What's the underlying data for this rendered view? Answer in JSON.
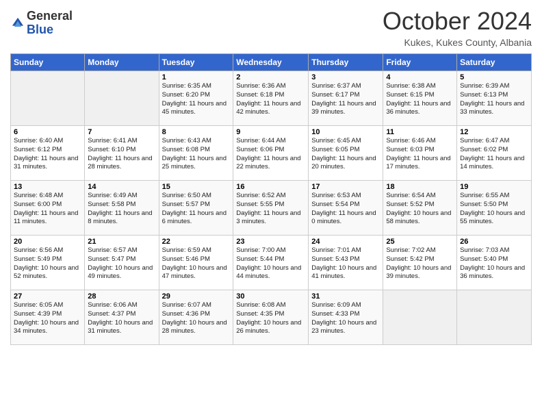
{
  "logo": {
    "general": "General",
    "blue": "Blue"
  },
  "title": "October 2024",
  "subtitle": "Kukes, Kukes County, Albania",
  "days_of_week": [
    "Sunday",
    "Monday",
    "Tuesday",
    "Wednesday",
    "Thursday",
    "Friday",
    "Saturday"
  ],
  "weeks": [
    [
      {
        "num": "",
        "info": ""
      },
      {
        "num": "",
        "info": ""
      },
      {
        "num": "1",
        "info": "Sunrise: 6:35 AM\nSunset: 6:20 PM\nDaylight: 11 hours and 45 minutes."
      },
      {
        "num": "2",
        "info": "Sunrise: 6:36 AM\nSunset: 6:18 PM\nDaylight: 11 hours and 42 minutes."
      },
      {
        "num": "3",
        "info": "Sunrise: 6:37 AM\nSunset: 6:17 PM\nDaylight: 11 hours and 39 minutes."
      },
      {
        "num": "4",
        "info": "Sunrise: 6:38 AM\nSunset: 6:15 PM\nDaylight: 11 hours and 36 minutes."
      },
      {
        "num": "5",
        "info": "Sunrise: 6:39 AM\nSunset: 6:13 PM\nDaylight: 11 hours and 33 minutes."
      }
    ],
    [
      {
        "num": "6",
        "info": "Sunrise: 6:40 AM\nSunset: 6:12 PM\nDaylight: 11 hours and 31 minutes."
      },
      {
        "num": "7",
        "info": "Sunrise: 6:41 AM\nSunset: 6:10 PM\nDaylight: 11 hours and 28 minutes."
      },
      {
        "num": "8",
        "info": "Sunrise: 6:43 AM\nSunset: 6:08 PM\nDaylight: 11 hours and 25 minutes."
      },
      {
        "num": "9",
        "info": "Sunrise: 6:44 AM\nSunset: 6:06 PM\nDaylight: 11 hours and 22 minutes."
      },
      {
        "num": "10",
        "info": "Sunrise: 6:45 AM\nSunset: 6:05 PM\nDaylight: 11 hours and 20 minutes."
      },
      {
        "num": "11",
        "info": "Sunrise: 6:46 AM\nSunset: 6:03 PM\nDaylight: 11 hours and 17 minutes."
      },
      {
        "num": "12",
        "info": "Sunrise: 6:47 AM\nSunset: 6:02 PM\nDaylight: 11 hours and 14 minutes."
      }
    ],
    [
      {
        "num": "13",
        "info": "Sunrise: 6:48 AM\nSunset: 6:00 PM\nDaylight: 11 hours and 11 minutes."
      },
      {
        "num": "14",
        "info": "Sunrise: 6:49 AM\nSunset: 5:58 PM\nDaylight: 11 hours and 8 minutes."
      },
      {
        "num": "15",
        "info": "Sunrise: 6:50 AM\nSunset: 5:57 PM\nDaylight: 11 hours and 6 minutes."
      },
      {
        "num": "16",
        "info": "Sunrise: 6:52 AM\nSunset: 5:55 PM\nDaylight: 11 hours and 3 minutes."
      },
      {
        "num": "17",
        "info": "Sunrise: 6:53 AM\nSunset: 5:54 PM\nDaylight: 11 hours and 0 minutes."
      },
      {
        "num": "18",
        "info": "Sunrise: 6:54 AM\nSunset: 5:52 PM\nDaylight: 10 hours and 58 minutes."
      },
      {
        "num": "19",
        "info": "Sunrise: 6:55 AM\nSunset: 5:50 PM\nDaylight: 10 hours and 55 minutes."
      }
    ],
    [
      {
        "num": "20",
        "info": "Sunrise: 6:56 AM\nSunset: 5:49 PM\nDaylight: 10 hours and 52 minutes."
      },
      {
        "num": "21",
        "info": "Sunrise: 6:57 AM\nSunset: 5:47 PM\nDaylight: 10 hours and 49 minutes."
      },
      {
        "num": "22",
        "info": "Sunrise: 6:59 AM\nSunset: 5:46 PM\nDaylight: 10 hours and 47 minutes."
      },
      {
        "num": "23",
        "info": "Sunrise: 7:00 AM\nSunset: 5:44 PM\nDaylight: 10 hours and 44 minutes."
      },
      {
        "num": "24",
        "info": "Sunrise: 7:01 AM\nSunset: 5:43 PM\nDaylight: 10 hours and 41 minutes."
      },
      {
        "num": "25",
        "info": "Sunrise: 7:02 AM\nSunset: 5:42 PM\nDaylight: 10 hours and 39 minutes."
      },
      {
        "num": "26",
        "info": "Sunrise: 7:03 AM\nSunset: 5:40 PM\nDaylight: 10 hours and 36 minutes."
      }
    ],
    [
      {
        "num": "27",
        "info": "Sunrise: 6:05 AM\nSunset: 4:39 PM\nDaylight: 10 hours and 34 minutes."
      },
      {
        "num": "28",
        "info": "Sunrise: 6:06 AM\nSunset: 4:37 PM\nDaylight: 10 hours and 31 minutes."
      },
      {
        "num": "29",
        "info": "Sunrise: 6:07 AM\nSunset: 4:36 PM\nDaylight: 10 hours and 28 minutes."
      },
      {
        "num": "30",
        "info": "Sunrise: 6:08 AM\nSunset: 4:35 PM\nDaylight: 10 hours and 26 minutes."
      },
      {
        "num": "31",
        "info": "Sunrise: 6:09 AM\nSunset: 4:33 PM\nDaylight: 10 hours and 23 minutes."
      },
      {
        "num": "",
        "info": ""
      },
      {
        "num": "",
        "info": ""
      }
    ]
  ]
}
